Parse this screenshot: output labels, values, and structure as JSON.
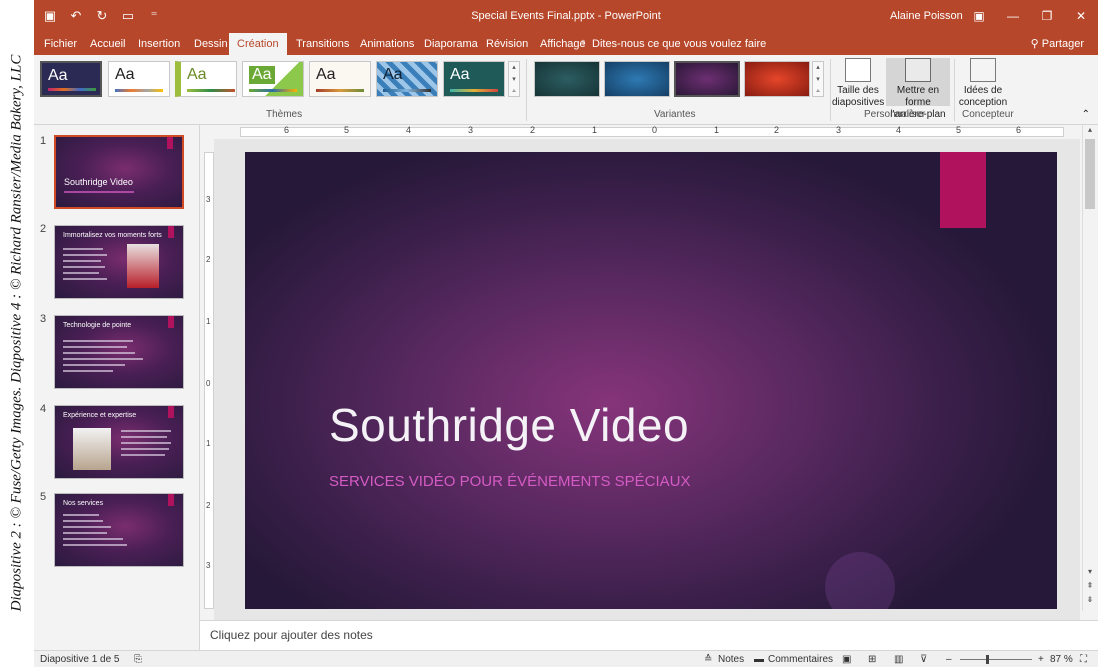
{
  "credit": "Diapositive 2 : © Fuse/Getty Images. Diapositive 4 : © Richard Ransier/Media Bakery, LLC",
  "titlebar": {
    "document_title": "Special Events Final.pptx - PowerPoint",
    "user": "Alaine Poisson",
    "qat_icons": [
      "save-icon",
      "undo-icon",
      "redo-icon",
      "slideshow-icon",
      "customize-icon"
    ]
  },
  "tabs": [
    "Fichier",
    "Accueil",
    "Insertion",
    "Dessin",
    "Création",
    "Transitions",
    "Animations",
    "Diaporama",
    "Révision",
    "Affichage"
  ],
  "active_tab": "Création",
  "tell_me": "Dites-nous ce que vous voulez faire",
  "share": "Partager",
  "ribbon": {
    "themes_label": "Thèmes",
    "variants_label": "Variantes",
    "customize_label": "Personnaliser",
    "designer_label": "Concepteur",
    "theme_aa": "Aa",
    "slide_size": "Taille des diapositives",
    "format_background": "Mettre en forme l'arrière-plan",
    "design_ideas": "Idées de conception"
  },
  "slides": [
    {
      "num": "1",
      "title": "Southridge Video"
    },
    {
      "num": "2",
      "title": "Immortalisez vos moments forts"
    },
    {
      "num": "3",
      "title": "Technologie de pointe"
    },
    {
      "num": "4",
      "title": "Expérience et expertise"
    },
    {
      "num": "5",
      "title": "Nos services"
    }
  ],
  "current_slide": {
    "title": "Southridge Video",
    "subtitle": "SERVICES VIDÉO POUR ÉVÉNEMENTS SPÉCIAUX"
  },
  "notes_placeholder": "Cliquez pour ajouter des notes",
  "status": {
    "slide_counter": "Diapositive 1 de 5",
    "notes": "Notes",
    "comments": "Commentaires",
    "zoom": "87 %"
  },
  "colors": {
    "brand": "#b7472a",
    "accent_tag": "#b0125e",
    "subtitle": "#d55bc4"
  }
}
